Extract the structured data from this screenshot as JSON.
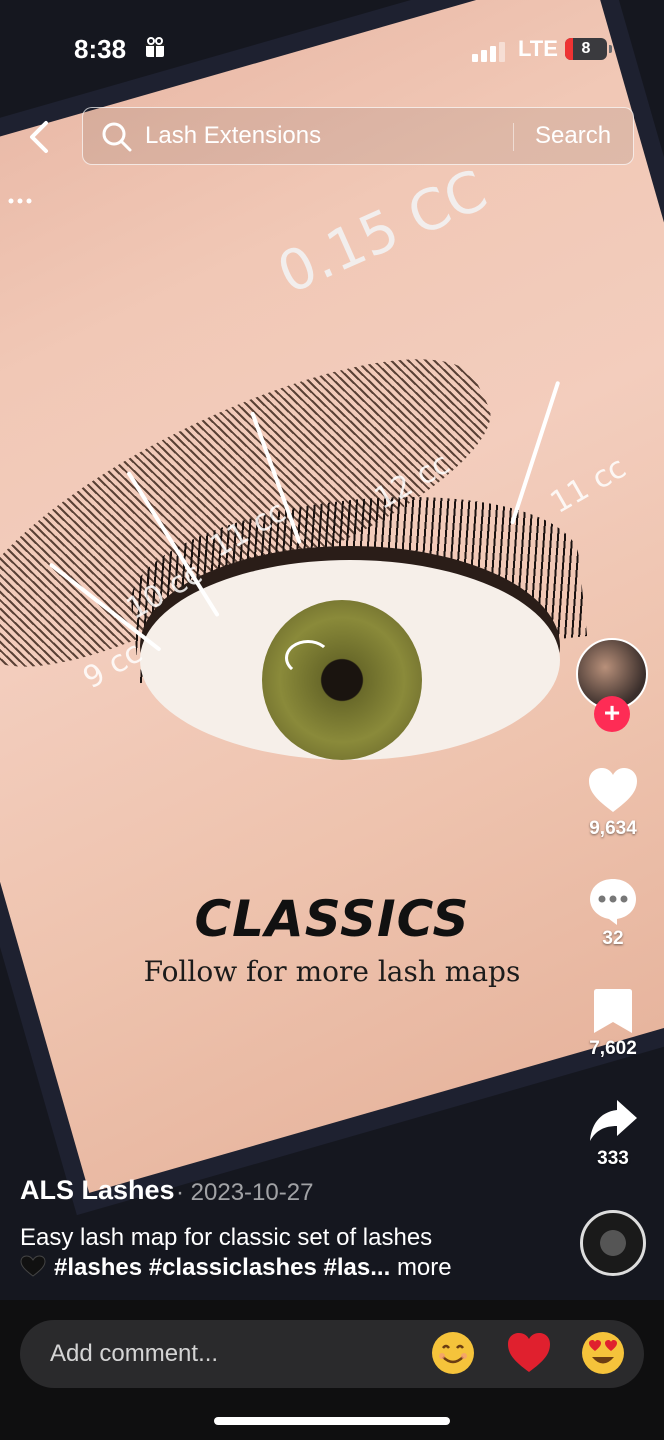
{
  "status_bar": {
    "time": "8:38",
    "network": "LTE",
    "battery": "8"
  },
  "search": {
    "query": "Lash Extensions",
    "button": "Search"
  },
  "video": {
    "overlay_title": "CLASSICS",
    "overlay_subtitle": "Follow for more lash maps",
    "annotation_top": "0.15 CC",
    "annotations": [
      "9 cc",
      "10 cc",
      "11 cc",
      "12 cc",
      "11 cc"
    ]
  },
  "actions": {
    "likes": "9,634",
    "comments": "32",
    "saves": "7,602",
    "shares": "333"
  },
  "post": {
    "author": "ALS Lashes",
    "date": "· 2023-10-27",
    "caption": "Easy lash map for classic set of lashes",
    "hashtags": "#lashes #classiclashes #las...",
    "more": "more"
  },
  "comment": {
    "placeholder": "Add comment..."
  },
  "colors": {
    "follow": "#fe2c55",
    "heart_emoji": "#e0202e"
  }
}
